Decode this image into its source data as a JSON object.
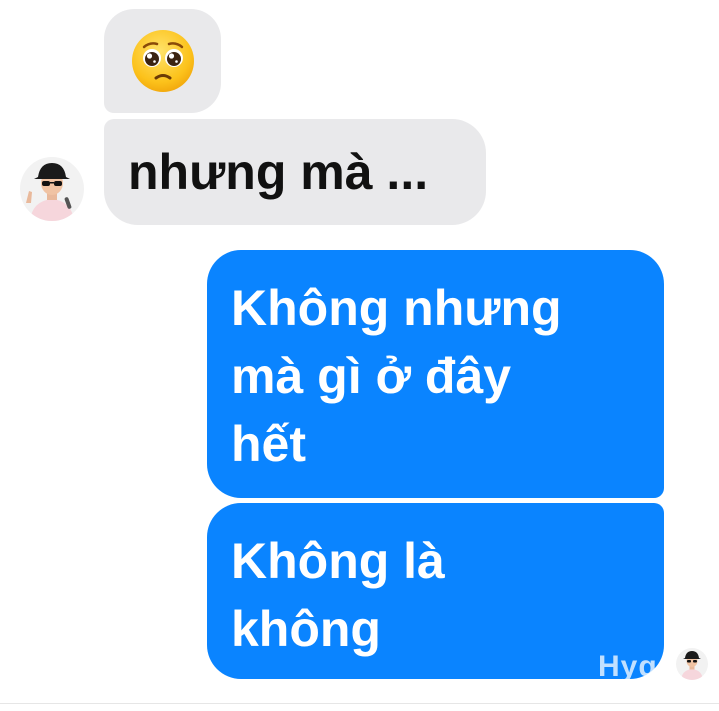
{
  "conversation": {
    "incoming": {
      "emoji_message": {
        "emoji_name": "pleading-face-emoji"
      },
      "text_message": {
        "text": "nhưng mà ..."
      }
    },
    "outgoing": [
      {
        "lines": [
          "Không nhưng",
          "mà gì ở đây",
          "hết"
        ]
      },
      {
        "lines": [
          "Không là",
          "không"
        ]
      }
    ]
  },
  "avatars": {
    "contact": "contact-avatar",
    "seen": "seen-receipt-avatar"
  },
  "watermark": {
    "text": "Hygge"
  },
  "colors": {
    "background": "#ffffff",
    "incoming_bubble": "#e9e9eb",
    "incoming_text": "#111111",
    "outgoing_bubble": "#0a84ff",
    "outgoing_text": "#ffffff"
  }
}
